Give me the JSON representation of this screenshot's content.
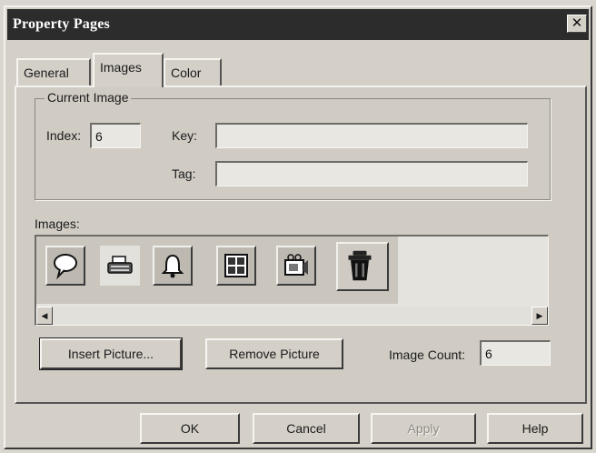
{
  "window": {
    "title": "Property Pages",
    "close_glyph": "✕"
  },
  "tabs": [
    {
      "label": "General",
      "selected": false
    },
    {
      "label": "Images",
      "selected": true
    },
    {
      "label": "Color",
      "selected": false
    }
  ],
  "current_image": {
    "group_label": "Current Image",
    "index_label": "Index:",
    "index_value": "6",
    "key_label": "Key:",
    "key_value": "",
    "tag_label": "Tag:",
    "tag_value": ""
  },
  "images": {
    "label": "Images:",
    "icons": [
      "speech-bubble-icon",
      "typewriter-icon",
      "bell-icon",
      "calendar-icon",
      "camera-icon",
      "trash-can-icon"
    ],
    "selected_index": 6
  },
  "actions": {
    "insert_label": "Insert Picture...",
    "remove_label": "Remove Picture",
    "count_label": "Image Count:",
    "count_value": "6"
  },
  "buttons": {
    "ok": "OK",
    "cancel": "Cancel",
    "apply": "Apply",
    "help": "Help"
  },
  "colors": {
    "titlebar": "#2c2c2c",
    "face": "#d4d0c8"
  }
}
